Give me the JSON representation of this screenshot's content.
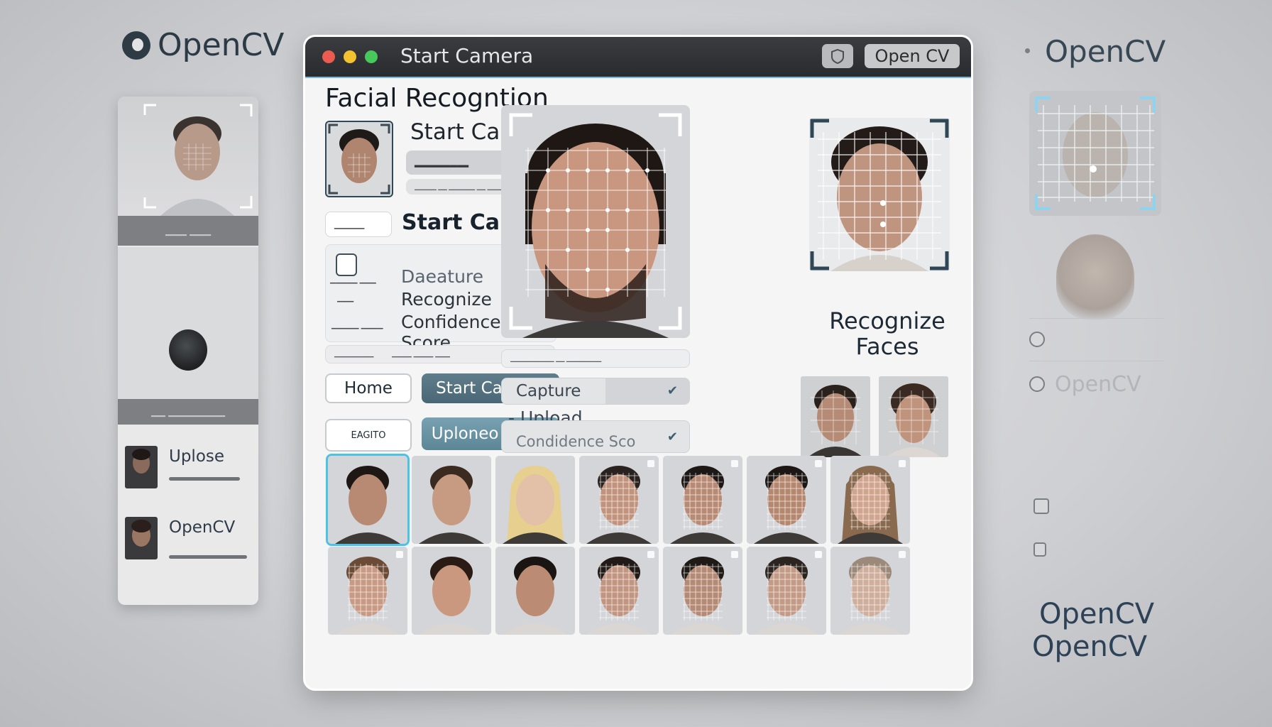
{
  "left": {
    "brand": "OpenCV",
    "upload_label": "Uplose",
    "opencv_label": "OpenCV"
  },
  "right": {
    "brand_top": "OpenCV",
    "item_text": "OpenCV",
    "brand_bottom_1": "OpenCV",
    "brand_bottom_2": "OpenCV"
  },
  "window": {
    "title": "Start Camera",
    "badge": "Open CV",
    "heading": "Facial Recogntion",
    "start_camera_1": "Start Camera",
    "start_camera_2": "Start Camera",
    "list_line_1": "Daeature",
    "list_line_2": "Recognize",
    "list_line_3": "Confidence Score",
    "home_button": "Home",
    "start_camera_button": "Start Camera",
    "small_button": "EAGITO",
    "upload_score_button": "Uploneo Score",
    "capture_option": "Capture",
    "upload_option": "Upload",
    "confidence_option": "Condidence Sco",
    "recognize_faces": "Recognize Faces"
  },
  "accent_color": "#4cc3e6",
  "icons": [
    "opencv-logo-icon",
    "camera-lens-icon",
    "chevron-down-icon",
    "shield-icon",
    "lock-icon"
  ]
}
